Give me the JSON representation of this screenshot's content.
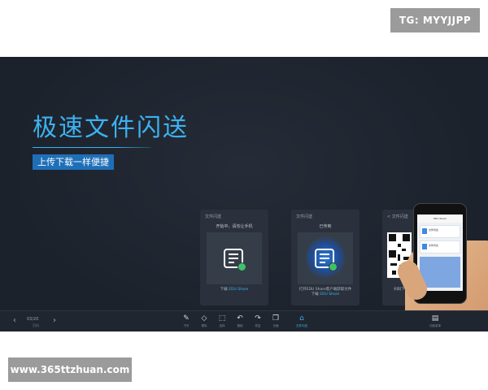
{
  "watermarks": {
    "top": "TG: MYYJJPP",
    "bottom": "www.365ttzhuan.com"
  },
  "slide": {
    "headline": "极速文件闪送",
    "subtitle": "上传下载一样便捷"
  },
  "cards": [
    {
      "title": "文件闪送",
      "status": "开始中，请勿让手机",
      "footer_prefix": "下载",
      "footer_link": "EDU Share"
    },
    {
      "title": "文件闪送",
      "status": "已传到",
      "footer_line1": "打开EDU Share客户端获取文件",
      "footer_prefix": "下载",
      "footer_link": "EDU Share"
    },
    {
      "title": "< 文件闪送",
      "footer": "扫码下载到本机"
    }
  ],
  "phone": {
    "topbar": "EDU Share",
    "rows": [
      "文件列表",
      "文件列表"
    ]
  },
  "toolbar": {
    "prev_icon": "chevron-left-icon",
    "page": "03/20",
    "page_sub": "页码",
    "next_icon": "chevron-right-icon",
    "tools": [
      {
        "icon": "pen-icon",
        "glyph": "✎",
        "label": "书写"
      },
      {
        "icon": "eraser-icon",
        "glyph": "◇",
        "label": "擦除"
      },
      {
        "icon": "select-icon",
        "glyph": "⬚",
        "label": "选择"
      },
      {
        "icon": "undo-icon",
        "glyph": "↶",
        "label": "撤销"
      },
      {
        "icon": "redo-icon",
        "glyph": "↷",
        "label": "恢复"
      },
      {
        "icon": "page-icon",
        "glyph": "❐",
        "label": "页面"
      },
      {
        "icon": "share-icon",
        "glyph": "⌂",
        "label": "文件闪送"
      },
      {
        "icon": "menu-icon",
        "glyph": "▤",
        "label": "功能菜单"
      }
    ]
  }
}
